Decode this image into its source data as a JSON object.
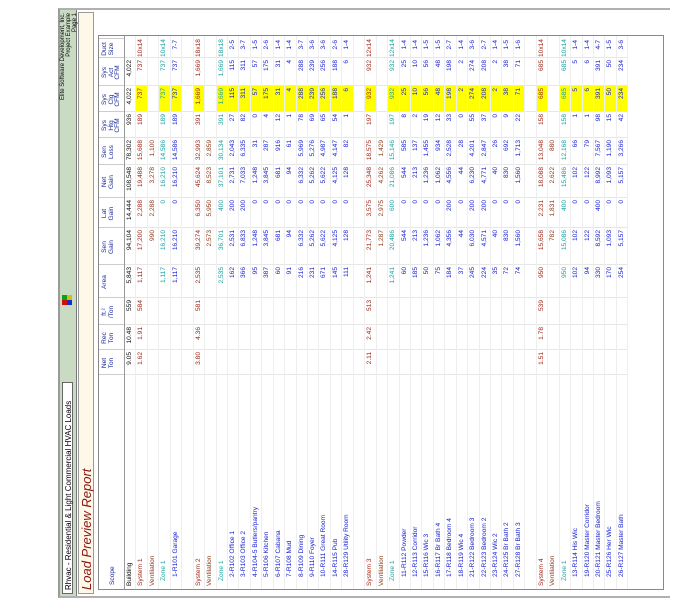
{
  "header": {
    "app_title": "Rhvac - Residential & Light Commercial HVAC Loads",
    "company": "Elite Software Development, Inc.",
    "project": "Project Example",
    "page": "Page 1"
  },
  "report_title": "Load Preview Report",
  "colors": {
    "highlight": "#ffff00",
    "system": "#a0281a",
    "zone": "#1aa0a0",
    "room": "#1a22d0"
  },
  "table": {
    "columns": [
      "Scope",
      "Net\nTon",
      "Rec\nTon",
      "ft.²\n/Ton",
      "Area",
      "Sen\nGain",
      "Lat\nGain",
      "Net\nGain",
      "Sen\nLoss",
      "Sys\nHtg\nCFM",
      "Sys\nClg\nCFM",
      "Sys\nAct\nCFM",
      "Duct\nSize"
    ],
    "rows": [
      {
        "type": "building",
        "cells": [
          "Building",
          "9.05",
          "10.48",
          "559",
          "5,843",
          "94,104",
          "14,444",
          "108,548",
          "78,302",
          "936",
          "4,022",
          "4,022",
          ""
        ]
      },
      {
        "type": "system",
        "cells": [
          "System 1",
          "1.62",
          "1.91",
          "584",
          "1,117",
          "17,200",
          "2,288",
          "19,488",
          "15,688",
          "189",
          "737",
          "737",
          "10x14"
        ]
      },
      {
        "type": "vent",
        "cells": [
          "Ventilation",
          "",
          "",
          "",
          "",
          "990",
          "2,288",
          "3,278",
          "1,100",
          "",
          "",
          "",
          ""
        ]
      },
      {
        "type": "zone",
        "cells": [
          "Zone 1",
          "",
          "",
          "",
          "1,117",
          "16,210",
          "0",
          "16,210",
          "14,586",
          "189",
          "737",
          "737",
          "10x14"
        ]
      },
      {
        "type": "room",
        "cells": [
          "1-R101 Garage",
          "",
          "",
          "",
          "1,117",
          "16,210",
          "0",
          "16,210",
          "14,586",
          "189",
          "737",
          "737",
          "7-7"
        ]
      },
      {
        "type": "blank",
        "cells": [
          "",
          "",
          "",
          "",
          "",
          "",
          "",
          "",
          "",
          "",
          "",
          "",
          ""
        ]
      },
      {
        "type": "system",
        "cells": [
          "System 2",
          "3.80",
          "4.36",
          "581",
          "2,535",
          "39,274",
          "6,350",
          "45,624",
          "32,993",
          "391",
          "1,669",
          "1,669",
          "18x18"
        ]
      },
      {
        "type": "vent",
        "cells": [
          "Ventilation",
          "",
          "",
          "",
          "",
          "2,573",
          "5,950",
          "8,523",
          "2,859",
          "",
          "",
          "",
          ""
        ]
      },
      {
        "type": "zone",
        "cells": [
          "Zone 1",
          "",
          "",
          "",
          "2,535",
          "36,701",
          "400",
          "37,101",
          "30,134",
          "391",
          "1,669",
          "1,669",
          "18x18"
        ]
      },
      {
        "type": "room",
        "cells": [
          "2-R102 Office 1",
          "",
          "",
          "",
          "162",
          "2,531",
          "200",
          "2,731",
          "2,043",
          "27",
          "115",
          "115",
          "2-5"
        ]
      },
      {
        "type": "room",
        "cells": [
          "3-R103 Office 2",
          "",
          "",
          "",
          "366",
          "6,833",
          "200",
          "7,033",
          "6,335",
          "82",
          "311",
          "311",
          "3-7"
        ]
      },
      {
        "type": "room",
        "cells": [
          "4-R104-5 Butlers/pantry",
          "",
          "",
          "",
          "95",
          "1,248",
          "0",
          "1,248",
          "31",
          "0",
          "57",
          "57",
          "1-5"
        ]
      },
      {
        "type": "room",
        "cells": [
          "5-R106 Kitchen",
          "",
          "",
          "",
          "387",
          "3,845",
          "0",
          "3,845",
          "287",
          "4",
          "175",
          "175",
          "2-6"
        ]
      },
      {
        "type": "room",
        "cells": [
          "6-R107 Cabana",
          "",
          "",
          "",
          "60",
          "681",
          "0",
          "681",
          "916",
          "12",
          "31",
          "31",
          "1-4"
        ]
      },
      {
        "type": "room",
        "cells": [
          "7-R108 Mud",
          "",
          "",
          "",
          "91",
          "94",
          "0",
          "94",
          "61",
          "1",
          "4",
          "4",
          "1-4"
        ]
      },
      {
        "type": "room",
        "cells": [
          "8-R109 Dining",
          "",
          "",
          "",
          "216",
          "6,332",
          "0",
          "6,332",
          "5,969",
          "78",
          "288",
          "288",
          "3-7"
        ]
      },
      {
        "type": "room",
        "cells": [
          "9-R110 Foyer",
          "",
          "",
          "",
          "231",
          "5,262",
          "0",
          "5,262",
          "5,276",
          "69",
          "239",
          "239",
          "3-6"
        ]
      },
      {
        "type": "room",
        "cells": [
          "10-R111 Great Room",
          "",
          "",
          "",
          "671",
          "5,622",
          "0",
          "5,622",
          "4,987",
          "65",
          "256",
          "256",
          "3-6"
        ]
      },
      {
        "type": "room",
        "cells": [
          "14-R115 Pub",
          "",
          "",
          "",
          "145",
          "4,125",
          "0",
          "4,125",
          "4,147",
          "54",
          "188",
          "188",
          "2-6"
        ]
      },
      {
        "type": "room",
        "cells": [
          "28-R129 Utility Room",
          "",
          "",
          "",
          "111",
          "128",
          "0",
          "128",
          "82",
          "1",
          "6",
          "6",
          "1-4"
        ]
      },
      {
        "type": "blank",
        "cells": [
          "",
          "",
          "",
          "",
          "",
          "",
          "",
          "",
          "",
          "",
          "",
          "",
          ""
        ]
      },
      {
        "type": "system",
        "cells": [
          "System 3",
          "2.11",
          "2.42",
          "513",
          "1,241",
          "21,773",
          "3,575",
          "25,348",
          "18,575",
          "197",
          "932",
          "932",
          "12x14"
        ]
      },
      {
        "type": "vent",
        "cells": [
          "Ventilation",
          "",
          "",
          "",
          "",
          "1,287",
          "2,975",
          "4,262",
          "1,429",
          "",
          "",
          "",
          ""
        ]
      },
      {
        "type": "zone",
        "cells": [
          "Zone 1",
          "",
          "",
          "",
          "1,241",
          "20,486",
          "600",
          "21,086",
          "15,146",
          "197",
          "932",
          "932",
          "12x14"
        ]
      },
      {
        "type": "room",
        "cells": [
          "11-R112 Powder",
          "",
          "",
          "",
          "60",
          "544",
          "0",
          "544",
          "585",
          "8",
          "25",
          "25",
          "1-4"
        ]
      },
      {
        "type": "room",
        "cells": [
          "12-R113 Corridor",
          "",
          "",
          "",
          "185",
          "213",
          "0",
          "213",
          "137",
          "2",
          "10",
          "10",
          "1-4"
        ]
      },
      {
        "type": "room",
        "cells": [
          "15-R116 Wic 3",
          "",
          "",
          "",
          "50",
          "1,236",
          "0",
          "1,236",
          "1,455",
          "19",
          "56",
          "56",
          "1-5"
        ]
      },
      {
        "type": "room",
        "cells": [
          "16-R117 Br Bath 4",
          "",
          "",
          "",
          "75",
          "1,062",
          "0",
          "1,062",
          "934",
          "12",
          "48",
          "48",
          "1-5"
        ]
      },
      {
        "type": "room",
        "cells": [
          "17-R118 Bedroom 4",
          "",
          "",
          "",
          "184",
          "4,356",
          "200",
          "4,556",
          "2,528",
          "33",
          "198",
          "198",
          "2-7"
        ]
      },
      {
        "type": "room",
        "cells": [
          "18-R119 Wic 4",
          "",
          "",
          "",
          "37",
          "44",
          "0",
          "44",
          "28",
          "0",
          "2",
          "2",
          "1-4"
        ]
      },
      {
        "type": "room",
        "cells": [
          "21-R122 Bedroom 3",
          "",
          "",
          "",
          "245",
          "6,030",
          "200",
          "6,230",
          "4,201",
          "55",
          "274",
          "274",
          "3-6"
        ]
      },
      {
        "type": "room",
        "cells": [
          "22-R123 Bedroom 2",
          "",
          "",
          "",
          "224",
          "4,571",
          "200",
          "4,771",
          "2,847",
          "37",
          "208",
          "208",
          "2-7"
        ]
      },
      {
        "type": "room",
        "cells": [
          "23-R124 Wic 2",
          "",
          "",
          "",
          "35",
          "40",
          "0",
          "40",
          "26",
          "0",
          "2",
          "2",
          "1-4"
        ]
      },
      {
        "type": "room",
        "cells": [
          "24-R125 Br Bath 2",
          "",
          "",
          "",
          "72",
          "830",
          "0",
          "830",
          "692",
          "9",
          "38",
          "38",
          "1-5"
        ]
      },
      {
        "type": "room",
        "cells": [
          "27-R128 Br Bath 3",
          "",
          "",
          "",
          "74",
          "1,560",
          "0",
          "1,560",
          "1,713",
          "22",
          "71",
          "71",
          "1-6"
        ]
      },
      {
        "type": "blank",
        "cells": [
          "",
          "",
          "",
          "",
          "",
          "",
          "",
          "",
          "",
          "",
          "",
          "",
          ""
        ]
      },
      {
        "type": "system",
        "cells": [
          "System 4",
          "1.51",
          "1.78",
          "539",
          "950",
          "15,658",
          "2,231",
          "18,088",
          "13,048",
          "158",
          "685",
          "685",
          "10x14"
        ]
      },
      {
        "type": "vent",
        "cells": [
          "Ventilation",
          "",
          "",
          "",
          "",
          "782",
          "1,831",
          "2,622",
          "880",
          "",
          "",
          "",
          ""
        ]
      },
      {
        "type": "zone",
        "cells": [
          "Zone 1",
          "",
          "",
          "",
          "950",
          "15,086",
          "400",
          "15,486",
          "12,168",
          "158",
          "685",
          "685",
          "10x14"
        ]
      },
      {
        "type": "room",
        "cells": [
          "13-R114 His Wic",
          "",
          "",
          "",
          "102",
          "102",
          "0",
          "102",
          "66",
          "1",
          "5",
          "5",
          "1-4"
        ]
      },
      {
        "type": "room",
        "cells": [
          "19-R120 Master Corridor",
          "",
          "",
          "",
          "94",
          "122",
          "0",
          "122",
          "79",
          "1",
          "6",
          "6",
          "1-4"
        ]
      },
      {
        "type": "room",
        "cells": [
          "20-R121 Master Bedroom",
          "",
          "",
          "",
          "330",
          "8,592",
          "400",
          "8,992",
          "7,567",
          "98",
          "391",
          "391",
          "4-7"
        ]
      },
      {
        "type": "room",
        "cells": [
          "25-R126 Her Wic",
          "",
          "",
          "",
          "170",
          "1,093",
          "0",
          "1,093",
          "1,190",
          "15",
          "50",
          "50",
          "1-5"
        ]
      },
      {
        "type": "room",
        "cells": [
          "26-R127 Master Bath",
          "",
          "",
          "",
          "254",
          "5,157",
          "0",
          "5,157",
          "3,266",
          "42",
          "234",
          "234",
          "3-6"
        ]
      }
    ]
  }
}
